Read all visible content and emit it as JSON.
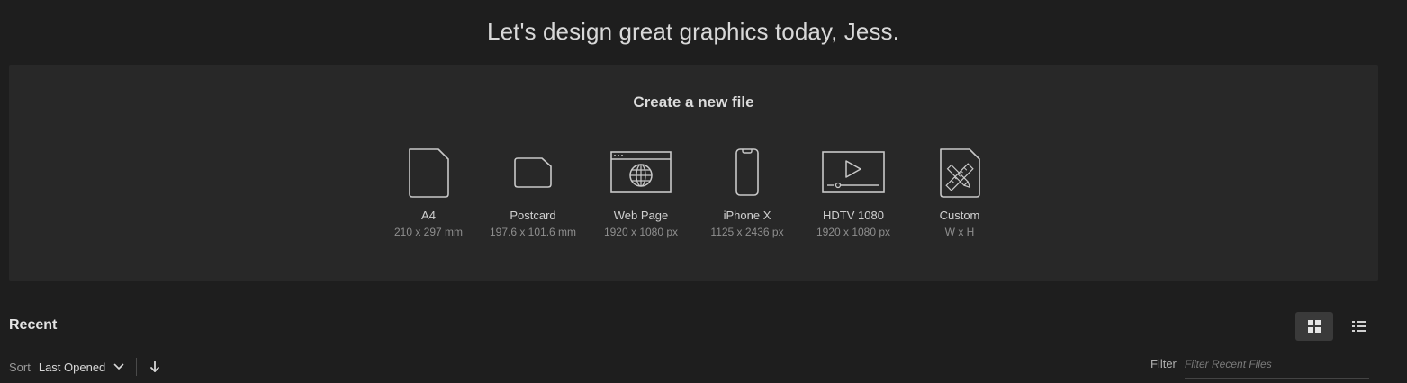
{
  "greeting": "Let's design great graphics today, Jess.",
  "create": {
    "title": "Create a new file",
    "presets": [
      {
        "name": "A4",
        "size": "210 x 297 mm",
        "icon": "document-icon"
      },
      {
        "name": "Postcard",
        "size": "197.6 x 101.6 mm",
        "icon": "postcard-icon"
      },
      {
        "name": "Web Page",
        "size": "1920 x 1080 px",
        "icon": "web-page-icon"
      },
      {
        "name": "iPhone X",
        "size": "1125 x 2436 px",
        "icon": "phone-icon"
      },
      {
        "name": "HDTV 1080",
        "size": "1920 x 1080 px",
        "icon": "video-icon"
      },
      {
        "name": "Custom",
        "size": "W x H",
        "icon": "custom-tools-icon"
      }
    ]
  },
  "recent": {
    "title": "Recent",
    "views": [
      {
        "icon": "grid-view-icon",
        "active": true
      },
      {
        "icon": "list-view-icon",
        "active": false
      }
    ],
    "sort": {
      "label": "Sort",
      "value": "Last Opened",
      "direction_icon": "arrow-down-icon"
    },
    "filter": {
      "label": "Filter",
      "placeholder": "Filter Recent Files",
      "value": ""
    }
  },
  "colors": {
    "background": "#1e1e1e",
    "panel": "#282828",
    "icon_stroke": "#c8c8c8"
  }
}
